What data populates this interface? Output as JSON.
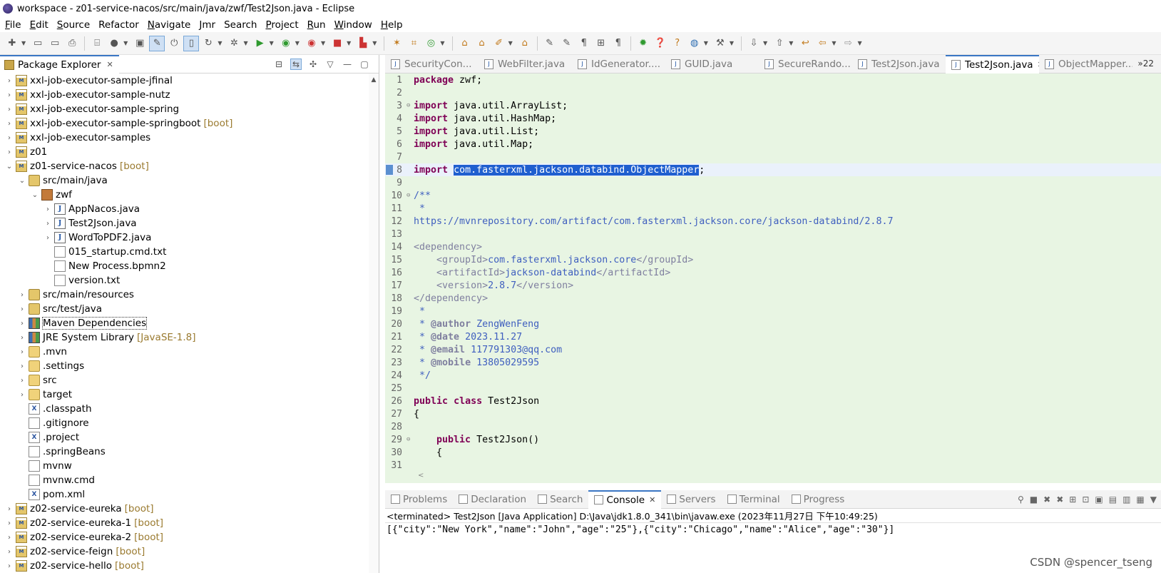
{
  "window": {
    "title": "workspace - z01-service-nacos/src/main/java/zwf/Test2Json.java - Eclipse"
  },
  "menu": [
    {
      "label": "File",
      "mnemonic": "F",
      "rest": "ile"
    },
    {
      "label": "Edit",
      "mnemonic": "E",
      "rest": "dit"
    },
    {
      "label": "Source",
      "mnemonic": "S",
      "rest": "ource"
    },
    {
      "label": "Refactor",
      "mnemonic": "",
      "rest": "Refactor"
    },
    {
      "label": "Navigate",
      "mnemonic": "N",
      "rest": "avigate"
    },
    {
      "label": "Jmr",
      "mnemonic": "J",
      "rest": "mr"
    },
    {
      "label": "Search",
      "mnemonic": "",
      "rest": "Search"
    },
    {
      "label": "Project",
      "mnemonic": "P",
      "rest": "roject"
    },
    {
      "label": "Run",
      "mnemonic": "R",
      "rest": "un"
    },
    {
      "label": "Window",
      "mnemonic": "W",
      "rest": "indow"
    },
    {
      "label": "Help",
      "mnemonic": "H",
      "rest": "elp"
    }
  ],
  "package_explorer": {
    "title": "Package Explorer",
    "items": [
      {
        "depth": 0,
        "twisty": "›",
        "icon": "project",
        "label": "xxl-job-executor-sample-jfinal",
        "suffix": ""
      },
      {
        "depth": 0,
        "twisty": "›",
        "icon": "project",
        "label": "xxl-job-executor-sample-nutz",
        "suffix": ""
      },
      {
        "depth": 0,
        "twisty": "›",
        "icon": "project",
        "label": "xxl-job-executor-sample-spring",
        "suffix": ""
      },
      {
        "depth": 0,
        "twisty": "›",
        "icon": "project",
        "label": "xxl-job-executor-sample-springboot",
        "suffix": "[boot]"
      },
      {
        "depth": 0,
        "twisty": "›",
        "icon": "project",
        "label": "xxl-job-executor-samples",
        "suffix": ""
      },
      {
        "depth": 0,
        "twisty": "›",
        "icon": "project",
        "label": "z01",
        "suffix": ""
      },
      {
        "depth": 0,
        "twisty": "⌄",
        "icon": "project",
        "label": "z01-service-nacos",
        "suffix": "[boot]"
      },
      {
        "depth": 1,
        "twisty": "⌄",
        "icon": "package-folder",
        "label": "src/main/java",
        "suffix": ""
      },
      {
        "depth": 2,
        "twisty": "⌄",
        "icon": "package",
        "label": "zwf",
        "suffix": ""
      },
      {
        "depth": 3,
        "twisty": "›",
        "icon": "java",
        "label": "AppNacos.java",
        "suffix": ""
      },
      {
        "depth": 3,
        "twisty": "›",
        "icon": "java",
        "label": "Test2Json.java",
        "suffix": "",
        "selected": true
      },
      {
        "depth": 3,
        "twisty": "›",
        "icon": "java",
        "label": "WordToPDF2.java",
        "suffix": ""
      },
      {
        "depth": 3,
        "twisty": "",
        "icon": "file",
        "label": "015_startup.cmd.txt",
        "suffix": ""
      },
      {
        "depth": 3,
        "twisty": "",
        "icon": "file",
        "label": "New Process.bpmn2",
        "suffix": ""
      },
      {
        "depth": 3,
        "twisty": "",
        "icon": "file",
        "label": "version.txt",
        "suffix": ""
      },
      {
        "depth": 1,
        "twisty": "›",
        "icon": "package-folder",
        "label": "src/main/resources",
        "suffix": ""
      },
      {
        "depth": 1,
        "twisty": "›",
        "icon": "package-folder",
        "label": "src/test/java",
        "suffix": ""
      },
      {
        "depth": 1,
        "twisty": "›",
        "icon": "library",
        "label": "Maven Dependencies",
        "suffix": "",
        "focused": true
      },
      {
        "depth": 1,
        "twisty": "›",
        "icon": "library",
        "label": "JRE System Library",
        "suffix": "[JavaSE-1.8]"
      },
      {
        "depth": 1,
        "twisty": "›",
        "icon": "folder",
        "label": ".mvn",
        "suffix": ""
      },
      {
        "depth": 1,
        "twisty": "›",
        "icon": "folder",
        "label": ".settings",
        "suffix": ""
      },
      {
        "depth": 1,
        "twisty": "›",
        "icon": "folder",
        "label": "src",
        "suffix": ""
      },
      {
        "depth": 1,
        "twisty": "›",
        "icon": "folder",
        "label": "target",
        "suffix": ""
      },
      {
        "depth": 1,
        "twisty": "",
        "icon": "xml",
        "label": ".classpath",
        "suffix": ""
      },
      {
        "depth": 1,
        "twisty": "",
        "icon": "file",
        "label": ".gitignore",
        "suffix": ""
      },
      {
        "depth": 1,
        "twisty": "",
        "icon": "xml",
        "label": ".project",
        "suffix": ""
      },
      {
        "depth": 1,
        "twisty": "",
        "icon": "file",
        "label": ".springBeans",
        "suffix": ""
      },
      {
        "depth": 1,
        "twisty": "",
        "icon": "file",
        "label": "mvnw",
        "suffix": ""
      },
      {
        "depth": 1,
        "twisty": "",
        "icon": "file",
        "label": "mvnw.cmd",
        "suffix": ""
      },
      {
        "depth": 1,
        "twisty": "",
        "icon": "xml",
        "label": "pom.xml",
        "suffix": ""
      },
      {
        "depth": 0,
        "twisty": "›",
        "icon": "project",
        "label": "z02-service-eureka",
        "suffix": "[boot]"
      },
      {
        "depth": 0,
        "twisty": "›",
        "icon": "project",
        "label": "z02-service-eureka-1",
        "suffix": "[boot]"
      },
      {
        "depth": 0,
        "twisty": "›",
        "icon": "project",
        "label": "z02-service-eureka-2",
        "suffix": "[boot]"
      },
      {
        "depth": 0,
        "twisty": "›",
        "icon": "project",
        "label": "z02-service-feign",
        "suffix": "[boot]"
      },
      {
        "depth": 0,
        "twisty": "›",
        "icon": "project",
        "label": "z02-service-hello",
        "suffix": "[boot]"
      }
    ]
  },
  "editor_tabs": [
    {
      "label": "SecurityCon...",
      "active": false
    },
    {
      "label": "WebFilter.java",
      "active": false
    },
    {
      "label": "IdGenerator....",
      "active": false
    },
    {
      "label": "GUID.java",
      "active": false
    },
    {
      "label": "SecureRando...",
      "active": false
    },
    {
      "label": "Test2Json.java",
      "active": false
    },
    {
      "label": "Test2Json.java",
      "active": true
    },
    {
      "label": "ObjectMapper...",
      "active": false
    }
  ],
  "editor_overflow": "»22",
  "code_lines": [
    {
      "n": "1",
      "fold": "",
      "html": "<span class='kw'>package</span> zwf;"
    },
    {
      "n": "2",
      "fold": "",
      "html": ""
    },
    {
      "n": "3",
      "fold": "⊖",
      "html": "<span class='kw'>import</span> java.util.ArrayList;"
    },
    {
      "n": "4",
      "fold": "",
      "html": "<span class='kw'>import</span> java.util.HashMap;"
    },
    {
      "n": "5",
      "fold": "",
      "html": "<span class='kw'>import</span> java.util.List;"
    },
    {
      "n": "6",
      "fold": "",
      "html": "<span class='kw'>import</span> java.util.Map;"
    },
    {
      "n": "7",
      "fold": "",
      "html": ""
    },
    {
      "n": "8",
      "fold": "",
      "html": "<span class='kw'>import</span> <span class='sel'>com.fasterxml.jackson.databind.ObjectMapper</span>;",
      "highlight": true,
      "marker": true
    },
    {
      "n": "9",
      "fold": "",
      "html": ""
    },
    {
      "n": "10",
      "fold": "⊖",
      "html": "<span class='cm'>/**</span>"
    },
    {
      "n": "11",
      "fold": "",
      "html": "<span class='cm'> *</span>"
    },
    {
      "n": "12",
      "fold": "",
      "html": "<span class='url'>https://mvnrepository.com/artifact/com.fasterxml.jackson.core/jackson-databind/2.8.7</span>"
    },
    {
      "n": "13",
      "fold": "",
      "html": ""
    },
    {
      "n": "14",
      "fold": "",
      "html": "<span class='tag'>&lt;dependency&gt;</span>"
    },
    {
      "n": "15",
      "fold": "",
      "html": "    <span class='tag'>&lt;groupId&gt;</span><span class='xml'>com.fasterxml.jackson.core</span><span class='tag'>&lt;/groupId&gt;</span>"
    },
    {
      "n": "16",
      "fold": "",
      "html": "    <span class='tag'>&lt;artifactId&gt;</span><span class='xml'>jackson-databind</span><span class='tag'>&lt;/artifactId&gt;</span>"
    },
    {
      "n": "17",
      "fold": "",
      "html": "    <span class='tag'>&lt;version&gt;</span><span class='xml'>2.8.7</span><span class='tag'>&lt;/version&gt;</span>"
    },
    {
      "n": "18",
      "fold": "",
      "html": "<span class='tag'>&lt;/dependency&gt;</span>"
    },
    {
      "n": "19",
      "fold": "",
      "html": "<span class='cm'> *</span>"
    },
    {
      "n": "20",
      "fold": "",
      "html": "<span class='cm'> * </span><span class='ann'>@author</span><span class='cm'> ZengWenFeng</span>"
    },
    {
      "n": "21",
      "fold": "",
      "html": "<span class='cm'> * </span><span class='ann'>@date</span><span class='cm'> 2023.11.27</span>"
    },
    {
      "n": "22",
      "fold": "",
      "html": "<span class='cm'> * </span><span class='ann'>@email</span><span class='cm'> 117791303@qq.com</span>"
    },
    {
      "n": "23",
      "fold": "",
      "html": "<span class='cm'> * </span><span class='ann'>@mobile</span><span class='cm'> 13805029595</span>"
    },
    {
      "n": "24",
      "fold": "",
      "html": "<span class='cm'> */</span>"
    },
    {
      "n": "25",
      "fold": "",
      "html": ""
    },
    {
      "n": "26",
      "fold": "",
      "html": "<span class='kw'>public</span> <span class='kw'>class</span> Test2Json"
    },
    {
      "n": "27",
      "fold": "",
      "html": "{"
    },
    {
      "n": "28",
      "fold": "",
      "html": ""
    },
    {
      "n": "29",
      "fold": "⊖",
      "html": "    <span class='kw'>public</span> Test2Json()"
    },
    {
      "n": "30",
      "fold": "",
      "html": "    {"
    },
    {
      "n": "31",
      "fold": "",
      "html": ""
    }
  ],
  "code_plain": [
    "package zwf;",
    "",
    "import java.util.ArrayList;",
    "import java.util.HashMap;",
    "import java.util.List;",
    "import java.util.Map;",
    "",
    "import com.fasterxml.jackson.databind.ObjectMapper;",
    "",
    "/**",
    " *",
    "https://mvnrepository.com/artifact/com.fasterxml.jackson.core/jackson-databind/2.8.7",
    "",
    "<dependency>",
    "    <groupId>com.fasterxml.jackson.core</groupId>",
    "    <artifactId>jackson-databind</artifactId>",
    "    <version>2.8.7</version>",
    "</dependency>",
    " *",
    " * @author ZengWenFeng",
    " * @date 2023.11.27",
    " * @email 117791303@qq.com",
    " * @mobile 13805029595",
    " */",
    "",
    "public class Test2Json",
    "{",
    "",
    "    public Test2Json()",
    "    {",
    ""
  ],
  "console_tabs": [
    {
      "label": "Problems",
      "active": false,
      "icon": "problems-icon"
    },
    {
      "label": "Declaration",
      "active": false,
      "icon": "declaration-icon"
    },
    {
      "label": "Search",
      "active": false,
      "icon": "search-icon"
    },
    {
      "label": "Console",
      "active": true,
      "icon": "console-icon"
    },
    {
      "label": "Servers",
      "active": false,
      "icon": "servers-icon"
    },
    {
      "label": "Terminal",
      "active": false,
      "icon": "terminal-icon"
    },
    {
      "label": "Progress",
      "active": false,
      "icon": "progress-icon"
    }
  ],
  "console": {
    "status": "<terminated> Test2Json [Java Application] D:\\Java\\jdk1.8.0_341\\bin\\javaw.exe (2023年11月27日 下午10:49:25)",
    "output": "[{\"city\":\"New York\",\"name\":\"John\",\"age\":\"25\"},{\"city\":\"Chicago\",\"name\":\"Alice\",\"age\":\"30\"}]"
  },
  "watermark": "CSDN @spencer_tseng",
  "colors": {
    "editor_bg": "#e8f5e3",
    "keyword": "#7f0055",
    "selection": "#1f5fcf",
    "tab_accent": "#3a76c4"
  }
}
